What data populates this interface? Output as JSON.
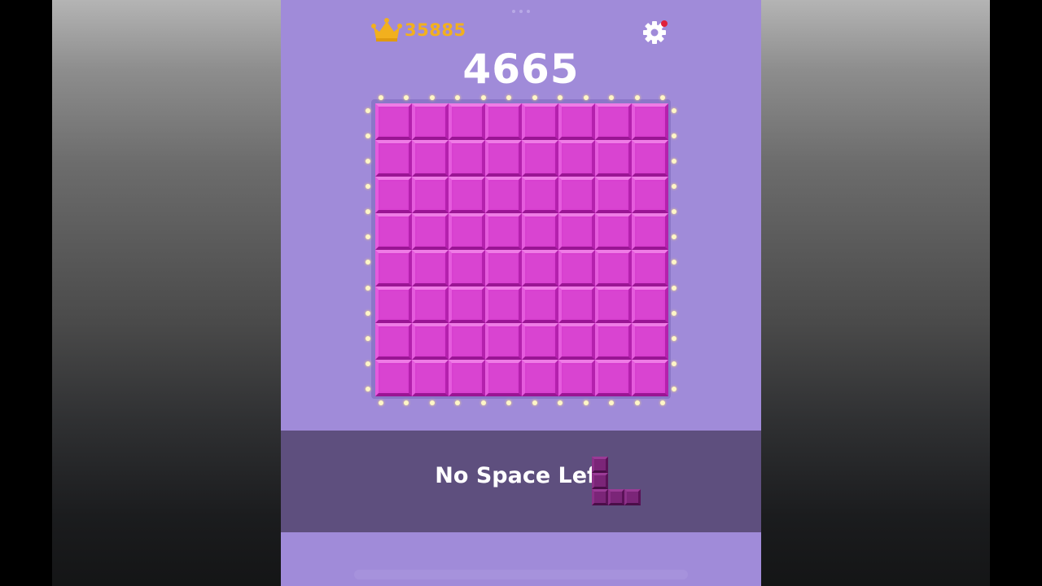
{
  "header": {
    "best_score": "35885",
    "current_score": "4665",
    "crown_icon": "crown-icon",
    "settings_icon": "gear-icon",
    "notification_color": "#e0203a"
  },
  "board": {
    "rows": 8,
    "cols": 8,
    "cell_color": "#d840d0",
    "background_color": "#a08bd9"
  },
  "game_over": {
    "message": "No Space Left"
  },
  "next_piece": {
    "shape": "L",
    "color": "#7b2578"
  }
}
